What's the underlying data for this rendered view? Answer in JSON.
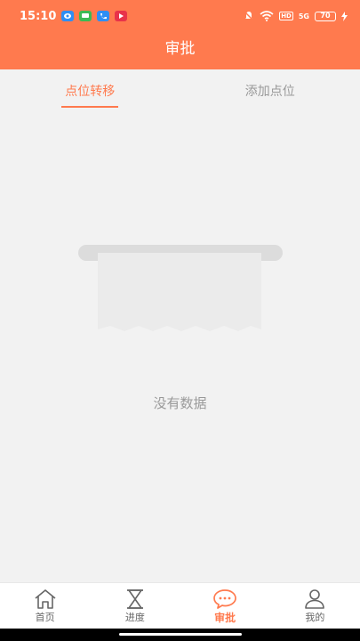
{
  "status_bar": {
    "time": "15:10",
    "signal_label": "5G",
    "hd_label": "HD",
    "battery": "70"
  },
  "header": {
    "title": "审批"
  },
  "tabs": [
    {
      "label": "点位转移",
      "active": true
    },
    {
      "label": "添加点位",
      "active": false
    }
  ],
  "empty_state": {
    "text": "没有数据"
  },
  "tabbar": [
    {
      "label": "首页",
      "icon": "home-icon",
      "active": false
    },
    {
      "label": "进度",
      "icon": "hourglass-icon",
      "active": false
    },
    {
      "label": "审批",
      "icon": "chat-icon",
      "active": true
    },
    {
      "label": "我的",
      "icon": "user-icon",
      "active": false
    }
  ],
  "colors": {
    "accent": "#ff7a4e",
    "background": "#f2f2f2"
  }
}
